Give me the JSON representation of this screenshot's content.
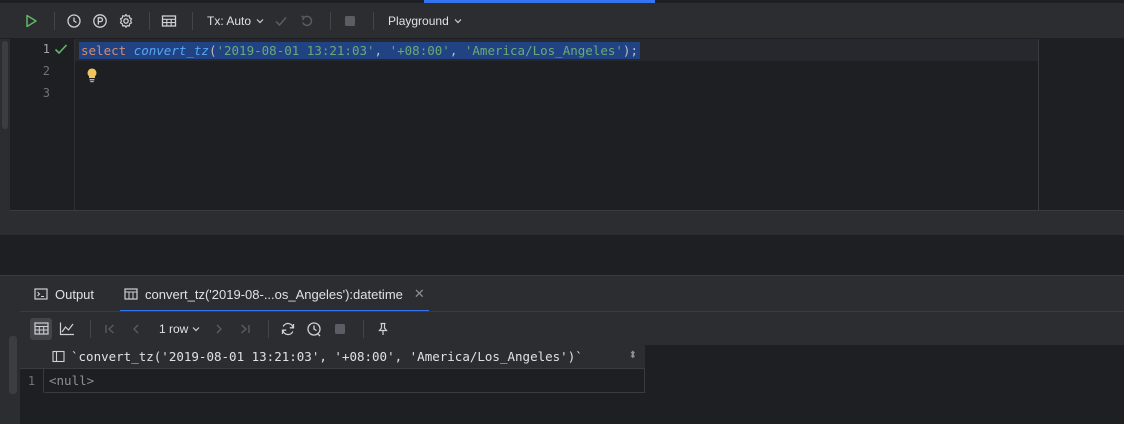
{
  "toolbar": {
    "tx_mode": "Tx: Auto",
    "session": "Playground"
  },
  "editor": {
    "line_numbers": [
      "1",
      "2",
      "3"
    ],
    "code_tokens": [
      {
        "type": "kw",
        "text": "select"
      },
      {
        "type": "sp",
        "text": " "
      },
      {
        "type": "fn",
        "text": "convert_tz"
      },
      {
        "type": "punc",
        "text": "("
      },
      {
        "type": "str",
        "text": "'2019-08-01 13:21:03'"
      },
      {
        "type": "punc",
        "text": ", "
      },
      {
        "type": "str",
        "text": "'+08:00'"
      },
      {
        "type": "punc",
        "text": ", "
      },
      {
        "type": "str",
        "text": "'America/Los_Angeles'"
      },
      {
        "type": "punc",
        "text": ");"
      }
    ]
  },
  "results": {
    "tabs": {
      "output": "Output",
      "query_result": "convert_tz('2019-08-...os_Angeles'):datetime"
    },
    "row_count": "1 row",
    "column_header": "`convert_tz('2019-08-01 13:21:03', '+08:00', 'America/Los_Angeles')`",
    "rows": [
      {
        "num": "1",
        "value": "<null>"
      }
    ]
  },
  "colors": {
    "accent": "#3574f0",
    "run_green": "#5fb865",
    "bulb_yellow": "#f2c55c"
  }
}
